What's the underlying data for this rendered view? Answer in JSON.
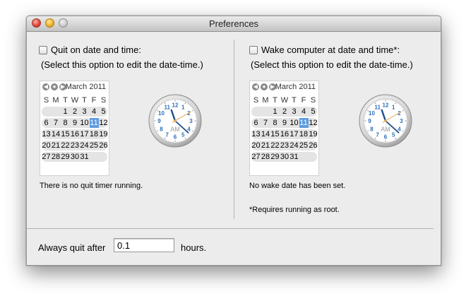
{
  "window": {
    "title": "Preferences"
  },
  "quit": {
    "checkbox_label": "Quit on date and time:",
    "hint": "(Select this option to edit the date-time.)",
    "status": "There is no quit timer running."
  },
  "wake": {
    "checkbox_label": "Wake computer at date and time*:",
    "hint": "(Select this option to edit the date-time.)",
    "status": "No wake date has been set.",
    "footnote": "*Requires running as root."
  },
  "calendar": {
    "month_label": "March 2011",
    "weekdays": [
      "S",
      "M",
      "T",
      "W",
      "T",
      "F",
      "S"
    ],
    "weeks": [
      [
        "",
        "",
        "1",
        "2",
        "3",
        "4",
        "5"
      ],
      [
        "6",
        "7",
        "8",
        "9",
        "10",
        "11",
        "12"
      ],
      [
        "13",
        "14",
        "15",
        "16",
        "17",
        "18",
        "19"
      ],
      [
        "20",
        "21",
        "22",
        "23",
        "24",
        "25",
        "26"
      ],
      [
        "27",
        "28",
        "29",
        "30",
        "31",
        "",
        ""
      ]
    ],
    "selected_day": "11",
    "nav_icons": [
      "back-arrow-icon",
      "today-dot-icon",
      "forward-arrow-icon"
    ]
  },
  "clock": {
    "numbers": [
      "12",
      "1",
      "2",
      "3",
      "4",
      "5",
      "6",
      "7",
      "8",
      "9",
      "10",
      "11"
    ],
    "ampm": "AM",
    "hour": 11,
    "minute": 22,
    "second": 10,
    "hand_color": "#1f4f8a",
    "second_hand_color": "#e3a44a",
    "number_color": "#2d6eb5"
  },
  "bottom": {
    "always_quit_label": "Always quit after",
    "hours_value": "0.1",
    "hours_label": "hours."
  }
}
